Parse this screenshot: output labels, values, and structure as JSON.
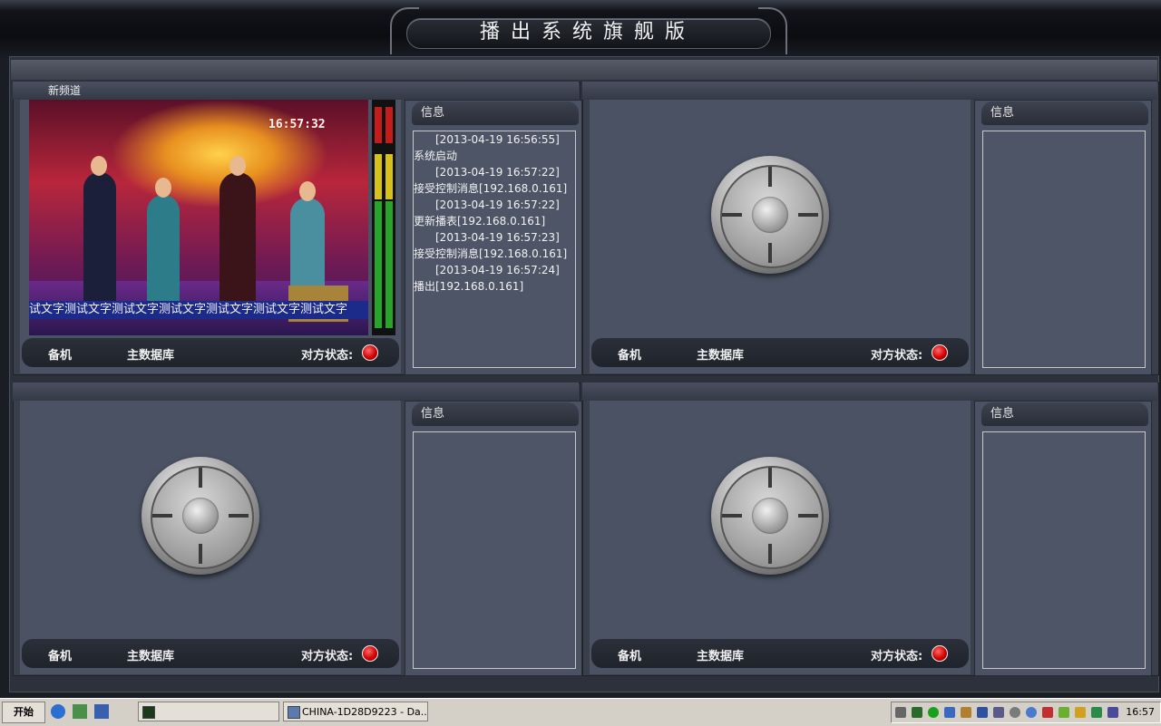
{
  "app": {
    "title": "播出系统旗舰版"
  },
  "channels": [
    {
      "name": "新频道",
      "has_video": true,
      "timecode": "16:57:32",
      "ticker": "试文字测试文字测试文字测试文字测试文字测试文字测试文字",
      "status_bar": {
        "role": "备机",
        "db": "主数据库",
        "peer_label": "对方状态:"
      },
      "info": {
        "header": "信息",
        "log": [
          {
            "text": "[2013-04-19 16:56:55]",
            "ts": true
          },
          {
            "text": "系统启动",
            "ts": false
          },
          {
            "text": "[2013-04-19 16:57:22]",
            "ts": true
          },
          {
            "text": "接受控制消息[192.168.0.161]",
            "ts": false
          },
          {
            "text": "[2013-04-19 16:57:22]",
            "ts": true
          },
          {
            "text": "更新播表[192.168.0.161]",
            "ts": false
          },
          {
            "text": "[2013-04-19 16:57:23]",
            "ts": true
          },
          {
            "text": "接受控制消息[192.168.0.161]",
            "ts": false
          },
          {
            "text": "[2013-04-19 16:57:24]",
            "ts": true
          },
          {
            "text": "播出[192.168.0.161]",
            "ts": false
          }
        ]
      }
    },
    {
      "name": "",
      "has_video": false,
      "status_bar": {
        "role": "备机",
        "db": "主数据库",
        "peer_label": "对方状态:"
      },
      "info": {
        "header": "信息",
        "log": []
      }
    },
    {
      "name": "",
      "has_video": false,
      "status_bar": {
        "role": "备机",
        "db": "主数据库",
        "peer_label": "对方状态:"
      },
      "info": {
        "header": "信息",
        "log": []
      }
    },
    {
      "name": "",
      "has_video": false,
      "status_bar": {
        "role": "备机",
        "db": "主数据库",
        "peer_label": "对方状态:"
      },
      "info": {
        "header": "信息",
        "log": []
      }
    }
  ],
  "taskbar": {
    "start_label": "开始",
    "tasks": [
      {
        "label": "",
        "icon": "console-icon"
      },
      {
        "label": "CHINA-1D28D9223 - Da...",
        "icon": "app-window-icon"
      }
    ],
    "clock": "16:57"
  },
  "colors": {
    "status_indicator": "#d10000",
    "panel_bg": "#4a5263"
  }
}
